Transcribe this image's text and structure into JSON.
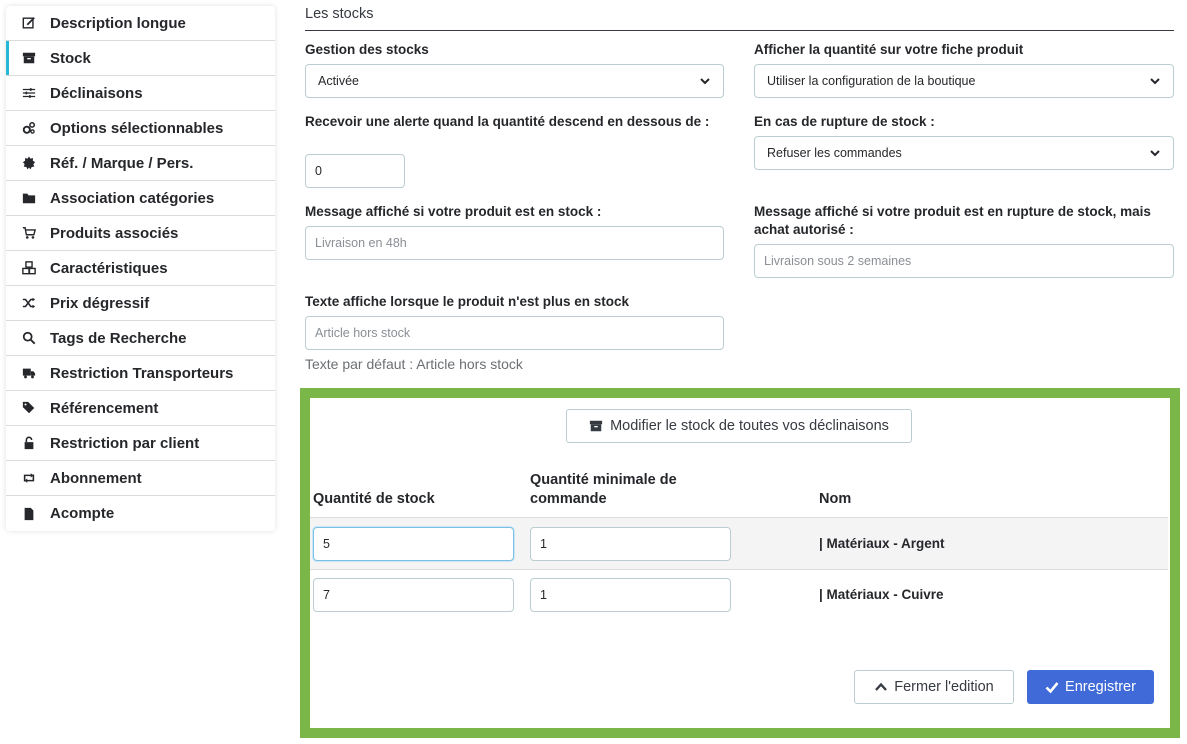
{
  "sidebar": {
    "items": [
      {
        "label": "Description longue",
        "icon": "edit-icon"
      },
      {
        "label": "Stock",
        "icon": "archive-icon",
        "active": true
      },
      {
        "label": "Déclinaisons",
        "icon": "sliders-icon"
      },
      {
        "label": "Options sélectionnables",
        "icon": "cogs-icon"
      },
      {
        "label": "Réf. / Marque / Pers.",
        "icon": "certificate-icon"
      },
      {
        "label": "Association catégories",
        "icon": "folder-icon"
      },
      {
        "label": "Produits associés",
        "icon": "cart-icon"
      },
      {
        "label": "Caractéristiques",
        "icon": "cubes-icon"
      },
      {
        "label": "Prix dégressif",
        "icon": "random-icon"
      },
      {
        "label": "Tags de Recherche",
        "icon": "search-icon"
      },
      {
        "label": "Restriction Transporteurs",
        "icon": "truck-icon"
      },
      {
        "label": "Référencement",
        "icon": "tags-icon"
      },
      {
        "label": "Restriction par client",
        "icon": "unlock-icon"
      },
      {
        "label": "Abonnement",
        "icon": "retweet-icon"
      },
      {
        "label": "Acompte",
        "icon": "file-icon"
      }
    ]
  },
  "form": {
    "section_title": "Les stocks",
    "stock_management_label": "Gestion des stocks",
    "stock_management_value": "Activée",
    "show_quantity_label": "Afficher la quantité sur votre fiche produit",
    "show_quantity_value": "Utiliser la configuration de la boutique",
    "alert_label": "Recevoir une alerte quand la quantité descend en dessous de :",
    "alert_value": "0",
    "out_of_stock_label": "En cas de rupture de stock :",
    "out_of_stock_value": "Refuser les commandes",
    "in_stock_msg_label": "Message affiché si votre produit est en stock  :",
    "in_stock_msg_placeholder": "Livraison en 48h",
    "backorder_msg_label": "Message affiché si votre produit est en rupture de stock, mais achat autorisé  :",
    "backorder_msg_placeholder": "Livraison sous 2 semaines",
    "no_stock_text_label": "Texte affiche lorsque le produit n'est plus en stock",
    "no_stock_text_placeholder": "Article hors stock",
    "no_stock_default_help": "Texte par défaut : Article hors stock"
  },
  "combinations": {
    "modify_all_label": "Modifier le stock de toutes vos déclinaisons",
    "headers": {
      "quantity": "Quantité de stock",
      "min_quantity": "Quantité minimale de commande",
      "name": "Nom"
    },
    "rows": [
      {
        "quantity": "5",
        "min_quantity": "1",
        "name": "| Matériaux - Argent"
      },
      {
        "quantity": "7",
        "min_quantity": "1",
        "name": "| Matériaux - Cuivre"
      }
    ],
    "close_label": "Fermer l'edition",
    "save_label": "Enregistrer"
  },
  "colors": {
    "highlight_border": "#7ab648",
    "primary_button": "#3f6ad8",
    "active_indicator": "#25b9d7"
  }
}
